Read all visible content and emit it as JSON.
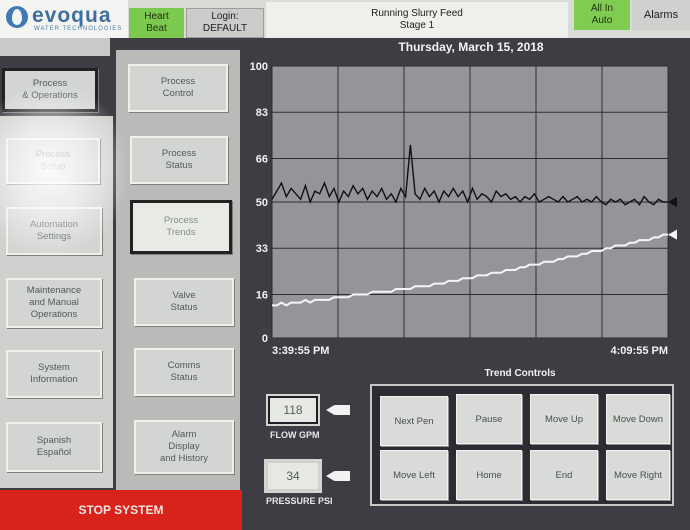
{
  "header": {
    "brand": "evoqua",
    "brand_sub": "WATER TECHNOLOGIES",
    "heartbeat_line1": "Heart",
    "heartbeat_line2": "Beat",
    "login_line1": "Login:",
    "login_line2": "DEFAULT",
    "status_line1": "Running Slurry Feed",
    "status_line2": "Stage 1",
    "auto_line1": "All In",
    "auto_line2": "Auto",
    "alarms": "Alarms"
  },
  "nav_left": {
    "process_operations_1": "Process",
    "process_operations_2": "& Operations",
    "setup_1": "Process",
    "setup_2": "Setup",
    "automation_1": "Automation",
    "automation_2": "Settings",
    "maintenance_1": "Maintenance",
    "maintenance_2": "and Manual",
    "maintenance_3": "Operations",
    "system_info_1": "System",
    "system_info_2": "Information",
    "spanish_1": "Spanish",
    "spanish_2": "Español"
  },
  "nav_mid": {
    "process_control_1": "Process",
    "process_control_2": "Control",
    "process_status_1": "Process",
    "process_status_2": "Status",
    "process_trends_1": "Process",
    "process_trends_2": "Trends",
    "valve_status_1": "Valve",
    "valve_status_2": "Status",
    "comms_status_1": "Comms",
    "comms_status_2": "Status",
    "alarm_display_1": "Alarm",
    "alarm_display_2": "Display",
    "alarm_display_3": "and History"
  },
  "stop_button": "STOP SYSTEM",
  "chart_data": {
    "type": "line",
    "title": "Thursday, March 15, 2018",
    "y_ticks": [
      "100",
      "83",
      "66",
      "50",
      "33",
      "16",
      "0"
    ],
    "ylim": [
      0,
      100
    ],
    "x_start_label": "3:39:55 PM",
    "x_end_label": "4:09:55 PM",
    "grid": true,
    "series": [
      {
        "color": "#111111",
        "values": [
          51,
          54,
          57,
          52,
          55,
          53,
          51,
          56,
          50,
          54,
          53,
          57,
          52,
          55,
          50,
          54,
          52,
          56,
          53,
          55,
          51,
          54,
          52,
          55,
          51,
          53,
          50,
          55,
          52,
          71,
          53,
          51,
          55,
          52,
          54,
          50,
          54,
          52,
          55,
          52,
          54,
          50,
          55,
          51,
          53,
          52,
          50,
          54,
          52,
          53,
          51,
          52,
          50,
          52,
          51,
          53,
          50,
          51,
          52,
          51,
          50,
          52,
          50,
          51,
          52,
          50,
          51,
          50,
          52,
          50,
          49,
          51,
          50,
          51,
          49,
          50,
          51,
          49,
          52,
          50,
          49,
          51,
          50,
          50
        ]
      },
      {
        "color": "#f5f5f5",
        "values": [
          12,
          12,
          13,
          12,
          13,
          13,
          13,
          14,
          13,
          14,
          14,
          14,
          14,
          15,
          15,
          15,
          15,
          16,
          16,
          16,
          16,
          17,
          17,
          17,
          17,
          17,
          18,
          18,
          18,
          18,
          19,
          19,
          19,
          19,
          20,
          20,
          20,
          21,
          21,
          21,
          22,
          22,
          22,
          23,
          23,
          23,
          24,
          24,
          24,
          25,
          25,
          25,
          26,
          26,
          27,
          27,
          27,
          28,
          28,
          28,
          29,
          29,
          30,
          30,
          30,
          31,
          31,
          32,
          32,
          32,
          33,
          33,
          34,
          34,
          34,
          35,
          35,
          36,
          36,
          36,
          37,
          37,
          38,
          38
        ]
      }
    ]
  },
  "gauges": {
    "flow_value": "118",
    "flow_label": "FLOW GPM",
    "pressure_value": "34",
    "pressure_label": "PRESSURE PSI"
  },
  "trend_controls": {
    "title": "Trend Controls",
    "next_pen": "Next Pen",
    "pause": "Pause",
    "move_up": "Move Up",
    "move_down": "Move Down",
    "move_left": "Move Left",
    "home": "Home",
    "end": "End",
    "move_right": "Move Right"
  }
}
